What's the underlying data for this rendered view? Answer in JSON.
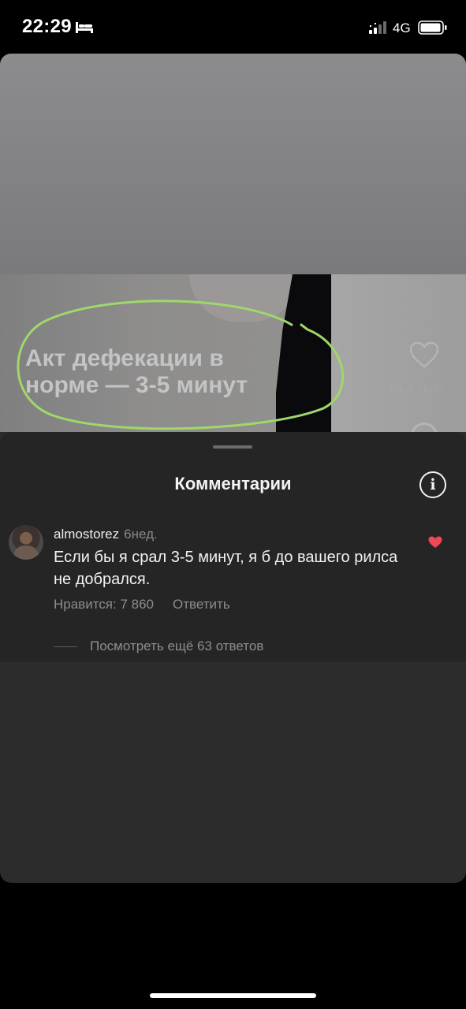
{
  "status_bar": {
    "time": "22:29",
    "network": "4G",
    "icons": [
      "bed-icon",
      "signal-icon",
      "battery-icon"
    ]
  },
  "video": {
    "caption_line1": "Акт дефекации в",
    "caption_line2": "норме — 3-5 минут",
    "like_count": "61,4 тыс.",
    "highlight_color": "#9fd86a"
  },
  "comments_sheet": {
    "title": "Комментарии",
    "info_icon": "info-icon",
    "comment": {
      "username": "almostorez",
      "time": "6нед.",
      "text": "Если бы я срал 3-5 минут, я б до вашего рилса не добрался.",
      "likes_label": "Нравится: 7 860",
      "reply_label": "Ответить",
      "liked": true,
      "like_color": "#ed4956"
    },
    "view_replies_label": "Посмотреть ещё 63 ответов"
  }
}
